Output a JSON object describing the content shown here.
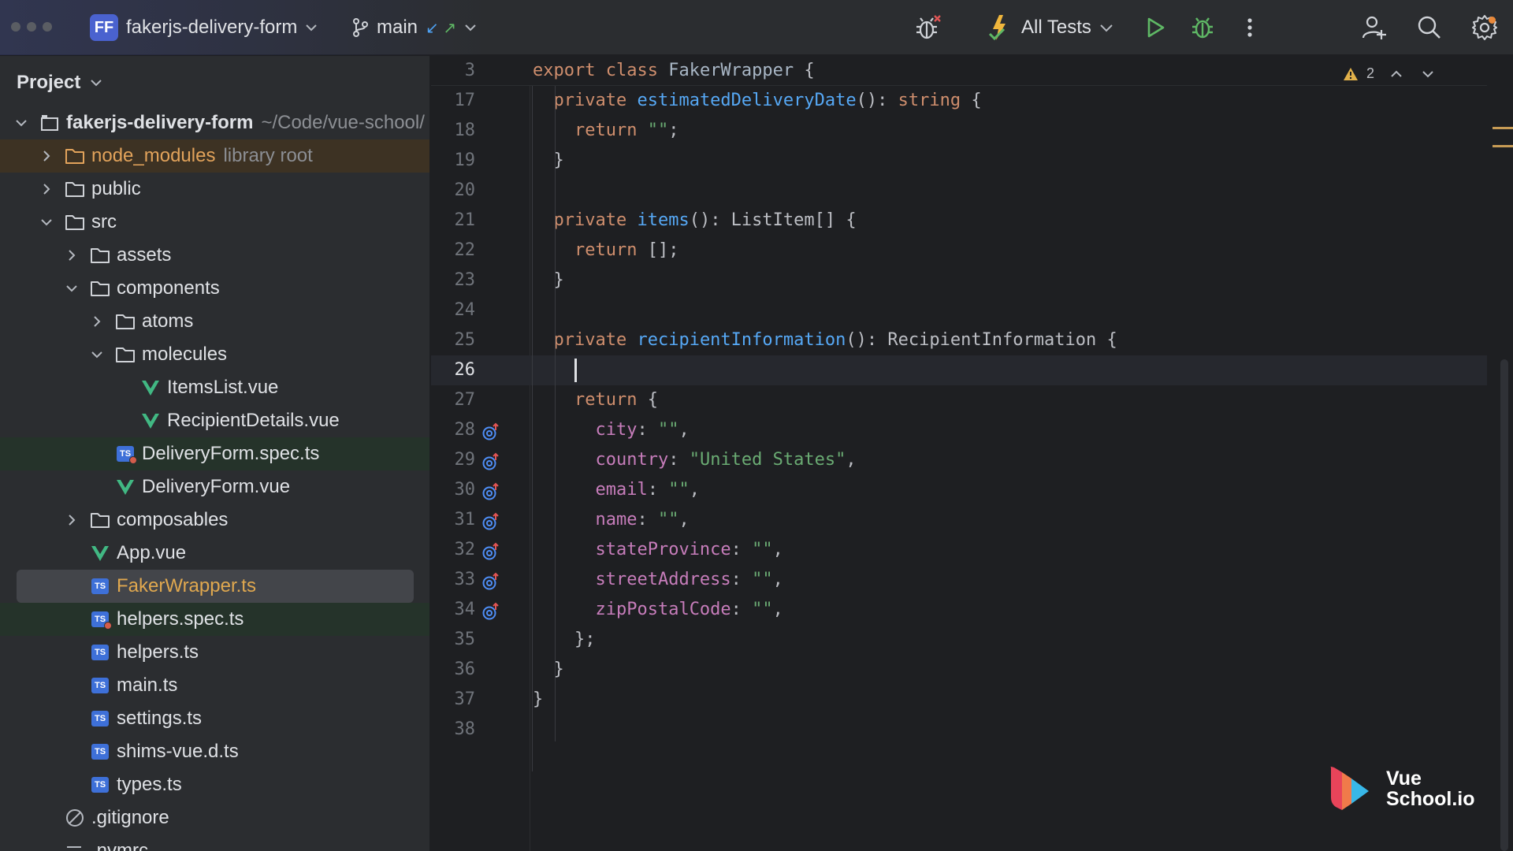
{
  "titlebar": {
    "project_badge": "FF",
    "project_name": "fakerjs-delivery-form",
    "branch": "main",
    "run_config": "All Tests"
  },
  "project_panel": {
    "title": "Project",
    "tree": [
      {
        "label": "fakerjs-delivery-form",
        "hint": "~/Code/vue-school/",
        "depth": 0,
        "expand": "open",
        "icon": "module-folder-icon",
        "style": "bold"
      },
      {
        "label": "node_modules",
        "hint": "library root",
        "depth": 1,
        "expand": "closed",
        "icon": "folder-icon",
        "style": "lib"
      },
      {
        "label": "public",
        "depth": 1,
        "expand": "closed",
        "icon": "folder-icon"
      },
      {
        "label": "src",
        "depth": 1,
        "expand": "open",
        "icon": "folder-icon"
      },
      {
        "label": "assets",
        "depth": 2,
        "expand": "closed",
        "icon": "folder-icon"
      },
      {
        "label": "components",
        "depth": 2,
        "expand": "open",
        "icon": "folder-icon"
      },
      {
        "label": "atoms",
        "depth": 3,
        "expand": "closed",
        "icon": "folder-icon"
      },
      {
        "label": "molecules",
        "depth": 3,
        "expand": "open",
        "icon": "folder-icon"
      },
      {
        "label": "ItemsList.vue",
        "depth": 4,
        "expand": "none",
        "icon": "vue-file-icon"
      },
      {
        "label": "RecipientDetails.vue",
        "depth": 4,
        "expand": "none",
        "icon": "vue-file-icon"
      },
      {
        "label": "DeliveryForm.spec.ts",
        "depth": 3,
        "expand": "none",
        "icon": "ts-test-file-icon",
        "style": "test"
      },
      {
        "label": "DeliveryForm.vue",
        "depth": 3,
        "expand": "none",
        "icon": "vue-file-icon"
      },
      {
        "label": "composables",
        "depth": 2,
        "expand": "closed",
        "icon": "folder-icon"
      },
      {
        "label": "App.vue",
        "depth": 2,
        "expand": "none",
        "icon": "vue-file-icon"
      },
      {
        "label": "FakerWrapper.ts",
        "depth": 2,
        "expand": "none",
        "icon": "ts-file-icon",
        "style": "selected"
      },
      {
        "label": "helpers.spec.ts",
        "depth": 2,
        "expand": "none",
        "icon": "ts-test-file-icon",
        "style": "test"
      },
      {
        "label": "helpers.ts",
        "depth": 2,
        "expand": "none",
        "icon": "ts-file-icon"
      },
      {
        "label": "main.ts",
        "depth": 2,
        "expand": "none",
        "icon": "ts-file-icon"
      },
      {
        "label": "settings.ts",
        "depth": 2,
        "expand": "none",
        "icon": "ts-file-icon"
      },
      {
        "label": "shims-vue.d.ts",
        "depth": 2,
        "expand": "none",
        "icon": "ts-file-icon"
      },
      {
        "label": "types.ts",
        "depth": 2,
        "expand": "none",
        "icon": "ts-file-icon"
      },
      {
        "label": ".gitignore",
        "depth": 1,
        "expand": "none",
        "icon": "ignored-file-icon"
      },
      {
        "label": ".nvmrc",
        "depth": 1,
        "expand": "none",
        "icon": "text-file-icon"
      }
    ]
  },
  "editor": {
    "inspection_count": "2",
    "sticky_line": {
      "number": "3",
      "tokens": [
        [
          "kw",
          "export "
        ],
        [
          "kw",
          "class "
        ],
        [
          "cls",
          "FakerWrapper"
        ],
        [
          "plain",
          " {"
        ]
      ]
    },
    "lines": [
      {
        "number": "17",
        "tokens": [
          [
            "plain",
            "  "
          ],
          [
            "kw",
            "private "
          ],
          [
            "fn",
            "estimatedDeliveryDate"
          ],
          [
            "plain",
            "(): "
          ],
          [
            "kw",
            "string"
          ],
          [
            "plain",
            " {"
          ]
        ]
      },
      {
        "number": "18",
        "tokens": [
          [
            "plain",
            "    "
          ],
          [
            "kw",
            "return "
          ],
          [
            "str",
            "\"\""
          ],
          [
            "plain",
            ";"
          ]
        ]
      },
      {
        "number": "19",
        "tokens": [
          [
            "plain",
            "  }"
          ]
        ]
      },
      {
        "number": "20",
        "tokens": []
      },
      {
        "number": "21",
        "tokens": [
          [
            "plain",
            "  "
          ],
          [
            "kw",
            "private "
          ],
          [
            "fn",
            "items"
          ],
          [
            "plain",
            "(): ListItem[] {"
          ]
        ]
      },
      {
        "number": "22",
        "tokens": [
          [
            "plain",
            "    "
          ],
          [
            "kw",
            "return "
          ],
          [
            "plain",
            "[];"
          ]
        ]
      },
      {
        "number": "23",
        "tokens": [
          [
            "plain",
            "  }"
          ]
        ]
      },
      {
        "number": "24",
        "tokens": []
      },
      {
        "number": "25",
        "tokens": [
          [
            "plain",
            "  "
          ],
          [
            "kw",
            "private "
          ],
          [
            "fn",
            "recipientInformation"
          ],
          [
            "plain",
            "(): RecipientInformation {"
          ]
        ]
      },
      {
        "number": "26",
        "tokens": [
          [
            "plain",
            "    "
          ],
          [
            "caret",
            ""
          ]
        ],
        "current": true
      },
      {
        "number": "27",
        "tokens": [
          [
            "plain",
            "    "
          ],
          [
            "kw",
            "return "
          ],
          [
            "plain",
            "{"
          ]
        ]
      },
      {
        "number": "28",
        "tokens": [
          [
            "plain",
            "      "
          ],
          [
            "prop",
            "city"
          ],
          [
            "plain",
            ": "
          ],
          [
            "str",
            "\"\""
          ],
          [
            "plain",
            ","
          ]
        ],
        "gutter": true
      },
      {
        "number": "29",
        "tokens": [
          [
            "plain",
            "      "
          ],
          [
            "prop",
            "country"
          ],
          [
            "plain",
            ": "
          ],
          [
            "str",
            "\"United States\""
          ],
          [
            "plain",
            ","
          ]
        ],
        "gutter": true
      },
      {
        "number": "30",
        "tokens": [
          [
            "plain",
            "      "
          ],
          [
            "prop",
            "email"
          ],
          [
            "plain",
            ": "
          ],
          [
            "str",
            "\"\""
          ],
          [
            "plain",
            ","
          ]
        ],
        "gutter": true
      },
      {
        "number": "31",
        "tokens": [
          [
            "plain",
            "      "
          ],
          [
            "prop",
            "name"
          ],
          [
            "plain",
            ": "
          ],
          [
            "str",
            "\"\""
          ],
          [
            "plain",
            ","
          ]
        ],
        "gutter": true
      },
      {
        "number": "32",
        "tokens": [
          [
            "plain",
            "      "
          ],
          [
            "prop",
            "stateProvince"
          ],
          [
            "plain",
            ": "
          ],
          [
            "str",
            "\"\""
          ],
          [
            "plain",
            ","
          ]
        ],
        "gutter": true
      },
      {
        "number": "33",
        "tokens": [
          [
            "plain",
            "      "
          ],
          [
            "prop",
            "streetAddress"
          ],
          [
            "plain",
            ": "
          ],
          [
            "str",
            "\"\""
          ],
          [
            "plain",
            ","
          ]
        ],
        "gutter": true
      },
      {
        "number": "34",
        "tokens": [
          [
            "plain",
            "      "
          ],
          [
            "prop",
            "zipPostalCode"
          ],
          [
            "plain",
            ": "
          ],
          [
            "str",
            "\"\""
          ],
          [
            "plain",
            ","
          ]
        ],
        "gutter": true
      },
      {
        "number": "35",
        "tokens": [
          [
            "plain",
            "    };"
          ]
        ]
      },
      {
        "number": "36",
        "tokens": [
          [
            "plain",
            "  }"
          ]
        ]
      },
      {
        "number": "37",
        "tokens": [
          [
            "plain",
            "}"
          ]
        ]
      },
      {
        "number": "38",
        "tokens": []
      }
    ]
  },
  "watermark": {
    "line1": "Vue",
    "line2": "School.io"
  },
  "colors": {
    "accent": "#4a62cf",
    "keyword": "#cf8e6d",
    "function": "#56a8f5",
    "string": "#6aab73",
    "property": "#c77dbb",
    "selection_file": "#e0a84f"
  }
}
